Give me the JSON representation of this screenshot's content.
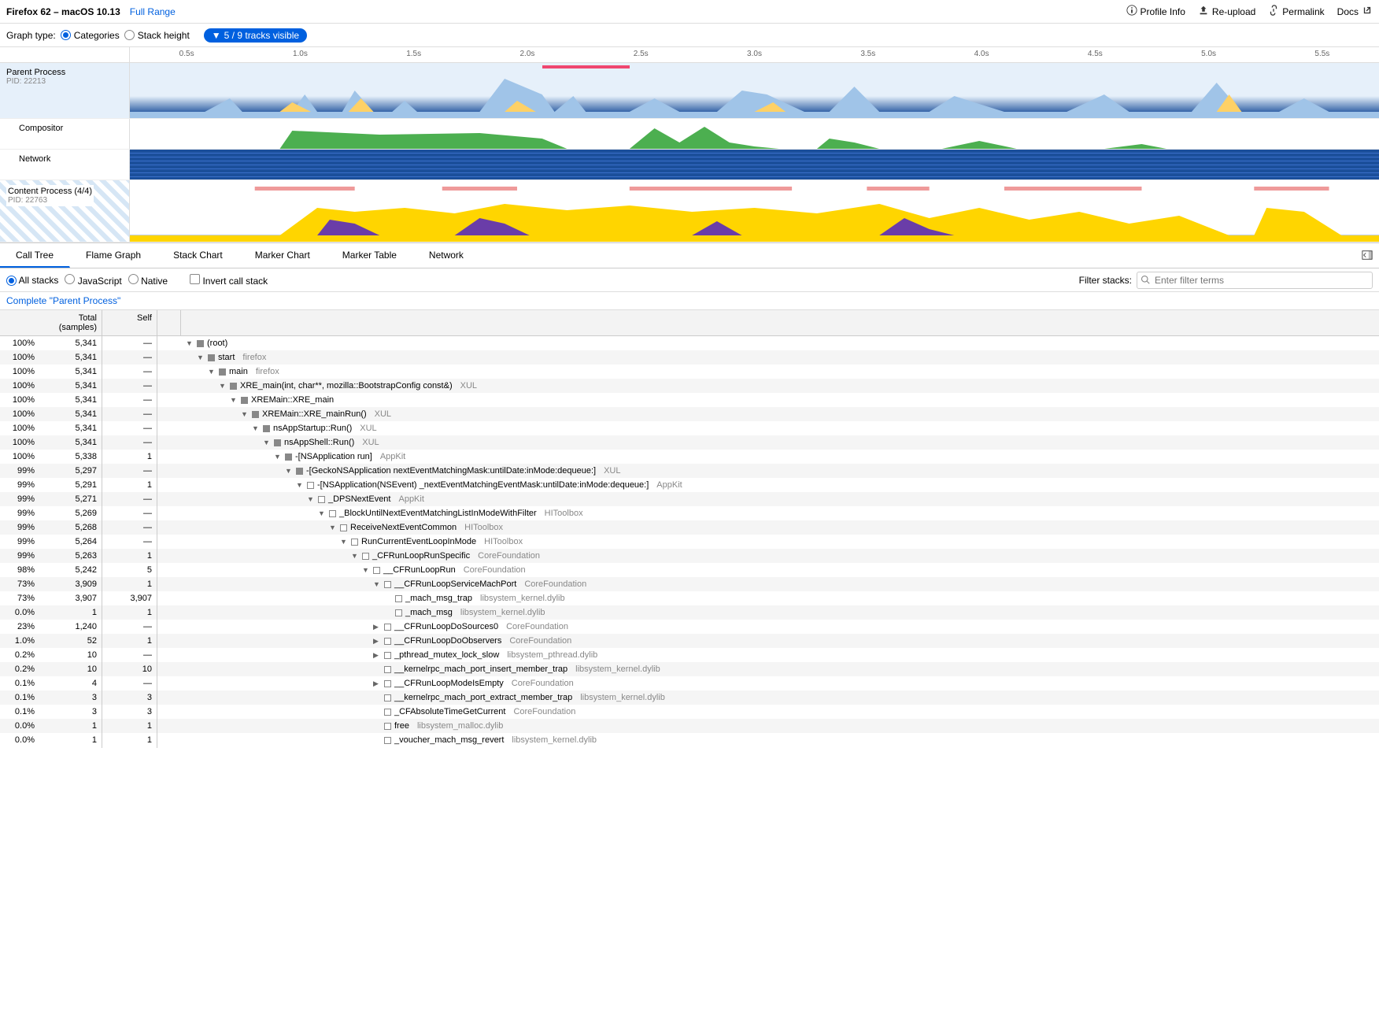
{
  "header": {
    "title": "Firefox 62 – macOS 10.13",
    "full_range": "Full Range",
    "profile_info": "Profile Info",
    "reupload": "Re-upload",
    "permalink": "Permalink",
    "docs": "Docs"
  },
  "graph_type": {
    "label": "Graph type:",
    "categories": "Categories",
    "stack_height": "Stack height",
    "tracks_visible": "5 / 9 tracks visible"
  },
  "ruler_ticks": [
    "0.5s",
    "1.0s",
    "1.5s",
    "2.0s",
    "2.5s",
    "3.0s",
    "3.5s",
    "4.0s",
    "4.5s",
    "5.0s",
    "5.5s"
  ],
  "tracks": {
    "parent": {
      "name": "Parent Process",
      "pid": "PID: 22213"
    },
    "compositor": {
      "name": "Compositor"
    },
    "network": {
      "name": "Network"
    },
    "content": {
      "name": "Content Process (4/4)",
      "pid": "PID: 22763"
    }
  },
  "tabs": [
    "Call Tree",
    "Flame Graph",
    "Stack Chart",
    "Marker Chart",
    "Marker Table",
    "Network"
  ],
  "filter": {
    "all_stacks": "All stacks",
    "javascript": "JavaScript",
    "native": "Native",
    "invert": "Invert call stack",
    "filter_label": "Filter stacks:",
    "filter_placeholder": "Enter filter terms"
  },
  "breadcrumb": "Complete \"Parent Process\"",
  "tree_headers": {
    "total": "Total (samples)",
    "self": "Self"
  },
  "tree_rows": [
    {
      "pct": "100%",
      "total": "5,341",
      "self": "—",
      "indent": 0,
      "arrow": "▼",
      "filled": true,
      "name": "(root)",
      "lib": ""
    },
    {
      "pct": "100%",
      "total": "5,341",
      "self": "—",
      "indent": 1,
      "arrow": "▼",
      "filled": true,
      "name": "start",
      "lib": "firefox"
    },
    {
      "pct": "100%",
      "total": "5,341",
      "self": "—",
      "indent": 2,
      "arrow": "▼",
      "filled": true,
      "name": "main",
      "lib": "firefox"
    },
    {
      "pct": "100%",
      "total": "5,341",
      "self": "—",
      "indent": 3,
      "arrow": "▼",
      "filled": true,
      "name": "XRE_main(int, char**, mozilla::BootstrapConfig const&)",
      "lib": "XUL"
    },
    {
      "pct": "100%",
      "total": "5,341",
      "self": "—",
      "indent": 4,
      "arrow": "▼",
      "filled": true,
      "name": "XREMain::XRE_main",
      "lib": ""
    },
    {
      "pct": "100%",
      "total": "5,341",
      "self": "—",
      "indent": 5,
      "arrow": "▼",
      "filled": true,
      "name": "XREMain::XRE_mainRun()",
      "lib": "XUL"
    },
    {
      "pct": "100%",
      "total": "5,341",
      "self": "—",
      "indent": 6,
      "arrow": "▼",
      "filled": true,
      "name": "nsAppStartup::Run()",
      "lib": "XUL"
    },
    {
      "pct": "100%",
      "total": "5,341",
      "self": "—",
      "indent": 7,
      "arrow": "▼",
      "filled": true,
      "name": "nsAppShell::Run()",
      "lib": "XUL"
    },
    {
      "pct": "100%",
      "total": "5,338",
      "self": "1",
      "indent": 8,
      "arrow": "▼",
      "filled": true,
      "name": "-[NSApplication run]",
      "lib": "AppKit"
    },
    {
      "pct": "99%",
      "total": "5,297",
      "self": "—",
      "indent": 9,
      "arrow": "▼",
      "filled": true,
      "name": "-[GeckoNSApplication nextEventMatchingMask:untilDate:inMode:dequeue:]",
      "lib": "XUL"
    },
    {
      "pct": "99%",
      "total": "5,291",
      "self": "1",
      "indent": 10,
      "arrow": "▼",
      "filled": false,
      "name": "-[NSApplication(NSEvent) _nextEventMatchingEventMask:untilDate:inMode:dequeue:]",
      "lib": "AppKit"
    },
    {
      "pct": "99%",
      "total": "5,271",
      "self": "—",
      "indent": 11,
      "arrow": "▼",
      "filled": false,
      "name": "_DPSNextEvent",
      "lib": "AppKit"
    },
    {
      "pct": "99%",
      "total": "5,269",
      "self": "—",
      "indent": 12,
      "arrow": "▼",
      "filled": false,
      "name": "_BlockUntilNextEventMatchingListInModeWithFilter",
      "lib": "HIToolbox"
    },
    {
      "pct": "99%",
      "total": "5,268",
      "self": "—",
      "indent": 13,
      "arrow": "▼",
      "filled": false,
      "name": "ReceiveNextEventCommon",
      "lib": "HIToolbox"
    },
    {
      "pct": "99%",
      "total": "5,264",
      "self": "—",
      "indent": 14,
      "arrow": "▼",
      "filled": false,
      "name": "RunCurrentEventLoopInMode",
      "lib": "HIToolbox"
    },
    {
      "pct": "99%",
      "total": "5,263",
      "self": "1",
      "indent": 15,
      "arrow": "▼",
      "filled": false,
      "name": "_CFRunLoopRunSpecific",
      "lib": "CoreFoundation"
    },
    {
      "pct": "98%",
      "total": "5,242",
      "self": "5",
      "indent": 16,
      "arrow": "▼",
      "filled": false,
      "name": "__CFRunLoopRun",
      "lib": "CoreFoundation"
    },
    {
      "pct": "73%",
      "total": "3,909",
      "self": "1",
      "indent": 17,
      "arrow": "▼",
      "filled": false,
      "name": "__CFRunLoopServiceMachPort",
      "lib": "CoreFoundation"
    },
    {
      "pct": "73%",
      "total": "3,907",
      "self": "3,907",
      "indent": 18,
      "arrow": "",
      "filled": false,
      "name": "_mach_msg_trap",
      "lib": "libsystem_kernel.dylib"
    },
    {
      "pct": "0.0%",
      "total": "1",
      "self": "1",
      "indent": 18,
      "arrow": "",
      "filled": false,
      "name": "_mach_msg",
      "lib": "libsystem_kernel.dylib"
    },
    {
      "pct": "23%",
      "total": "1,240",
      "self": "—",
      "indent": 17,
      "arrow": "▶",
      "filled": false,
      "name": "__CFRunLoopDoSources0",
      "lib": "CoreFoundation"
    },
    {
      "pct": "1.0%",
      "total": "52",
      "self": "1",
      "indent": 17,
      "arrow": "▶",
      "filled": false,
      "name": "__CFRunLoopDoObservers",
      "lib": "CoreFoundation"
    },
    {
      "pct": "0.2%",
      "total": "10",
      "self": "—",
      "indent": 17,
      "arrow": "▶",
      "filled": false,
      "name": "_pthread_mutex_lock_slow",
      "lib": "libsystem_pthread.dylib"
    },
    {
      "pct": "0.2%",
      "total": "10",
      "self": "10",
      "indent": 17,
      "arrow": "",
      "filled": false,
      "name": "__kernelrpc_mach_port_insert_member_trap",
      "lib": "libsystem_kernel.dylib"
    },
    {
      "pct": "0.1%",
      "total": "4",
      "self": "—",
      "indent": 17,
      "arrow": "▶",
      "filled": false,
      "name": "__CFRunLoopModeIsEmpty",
      "lib": "CoreFoundation"
    },
    {
      "pct": "0.1%",
      "total": "3",
      "self": "3",
      "indent": 17,
      "arrow": "",
      "filled": false,
      "name": "__kernelrpc_mach_port_extract_member_trap",
      "lib": "libsystem_kernel.dylib"
    },
    {
      "pct": "0.1%",
      "total": "3",
      "self": "3",
      "indent": 17,
      "arrow": "",
      "filled": false,
      "name": "_CFAbsoluteTimeGetCurrent",
      "lib": "CoreFoundation"
    },
    {
      "pct": "0.0%",
      "total": "1",
      "self": "1",
      "indent": 17,
      "arrow": "",
      "filled": false,
      "name": "free",
      "lib": "libsystem_malloc.dylib"
    },
    {
      "pct": "0.0%",
      "total": "1",
      "self": "1",
      "indent": 17,
      "arrow": "",
      "filled": false,
      "name": "_voucher_mach_msg_revert",
      "lib": "libsystem_kernel.dylib"
    }
  ]
}
